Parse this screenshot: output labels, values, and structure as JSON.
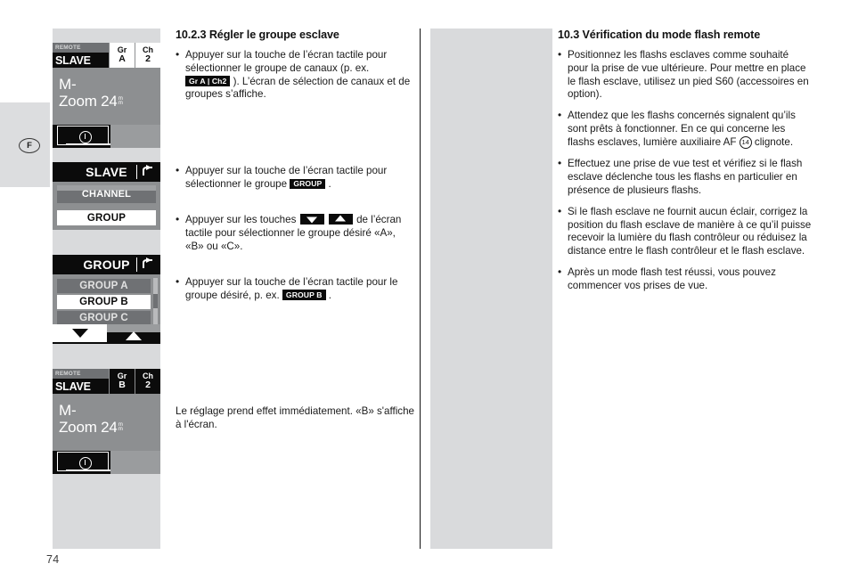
{
  "page": {
    "number": "74",
    "language_marker": "F"
  },
  "lcd_screens": [
    {
      "id": "status-top",
      "remote_label": "REMOTE",
      "mode_label": "SLAVE",
      "group_key": "Gr",
      "group_value": "A",
      "group_inverted": false,
      "channel_key": "Ch",
      "channel_value": "2",
      "channel_inverted": false,
      "line1": "M-",
      "line2": "Zoom 24",
      "unit": "mm"
    },
    {
      "id": "slave-menu",
      "header": "SLAVE",
      "back_icon": "back-arrow-icon",
      "item_channel": "CHANNEL",
      "item_group": "GROUP"
    },
    {
      "id": "group-menu",
      "header": "GROUP",
      "back_icon": "back-arrow-icon",
      "items": [
        "GROUP A",
        "GROUP B",
        "GROUP C"
      ],
      "selected": "GROUP B",
      "nav_down_icon": "triangle-down-icon",
      "nav_up_icon": "triangle-up-icon"
    },
    {
      "id": "status-bottom",
      "remote_label": "REMOTE",
      "mode_label": "SLAVE",
      "group_key": "Gr",
      "group_value": "B",
      "group_inverted": true,
      "channel_key": "Ch",
      "channel_value": "2",
      "channel_inverted": true,
      "line1": "M-",
      "line2": "Zoom 24",
      "unit": "mm"
    }
  ],
  "middle_column": {
    "heading": "10.2.3 Régler le groupe esclave",
    "bullet1": {
      "part1": "Appuyer sur la touche de l’écran tactile pour sélectionner le groupe de canaux (p. ex. ",
      "badge": "Gr A | Ch2",
      "part2": " ). L’écran de sélection de canaux et de groupes s’affiche."
    },
    "bullet2": {
      "part1": "Appuyer sur la touche de l’écran tactile pour sélectionner le groupe ",
      "badge": "GROUP",
      "part2": " ."
    },
    "bullet3": {
      "part1": "Appuyer sur les touches ",
      "arrow_down": "triangle-down-icon",
      "arrow_up": "triangle-up-icon",
      "part2": " de l’écran tactile pour sélectionner le groupe désiré «A», «B» ou «C»."
    },
    "bullet4": {
      "part1": "Appuyer sur la touche de l’écran tactile pour le groupe désiré, p. ex. ",
      "badge": "GROUP B",
      "part2": " ."
    },
    "closing": "Le réglage prend effet immédiatement. «B» s'affiche à l'écran."
  },
  "right_column": {
    "heading": "10.3 Vérification du mode flash remote",
    "bullet1": "Positionnez les flashs esclaves comme souhaité pour la prise de vue ultérieure. Pour mettre en place le flash esclave, utilisez un pied S60 (accessoires en option).",
    "bullet2": {
      "part1": "Attendez que les flashs concernés signalent qu’ils sont prêts à fonctionner. En ce qui concerne les flashs esclaves, lumière auxiliaire AF ",
      "ref": "14",
      "part2": " clignote."
    },
    "bullet3": "Effectuez une prise de vue test et vérifiez si le flash esclave déclenche tous les flashs en particulier en présence de plusieurs flashs.",
    "bullet4": "Si le flash esclave ne fournit aucun éclair, corrigez la position du flash esclave de manière à ce qu’il puisse recevoir la lumière du flash contrôleur ou réduisez la distance entre le flash contrôleur et le flash esclave.",
    "bullet5": "Après un mode flash test réussi, vous pouvez commencer vos prises de vue."
  },
  "colors": {
    "lcd_background": "#8d8f91",
    "lcd_dark": "#0b0b0b",
    "lcd_dim_row": "#6f7174",
    "column_gray": "#d9dadc",
    "tab_gray": "#dcdddf",
    "text": "#1a1a1a"
  }
}
